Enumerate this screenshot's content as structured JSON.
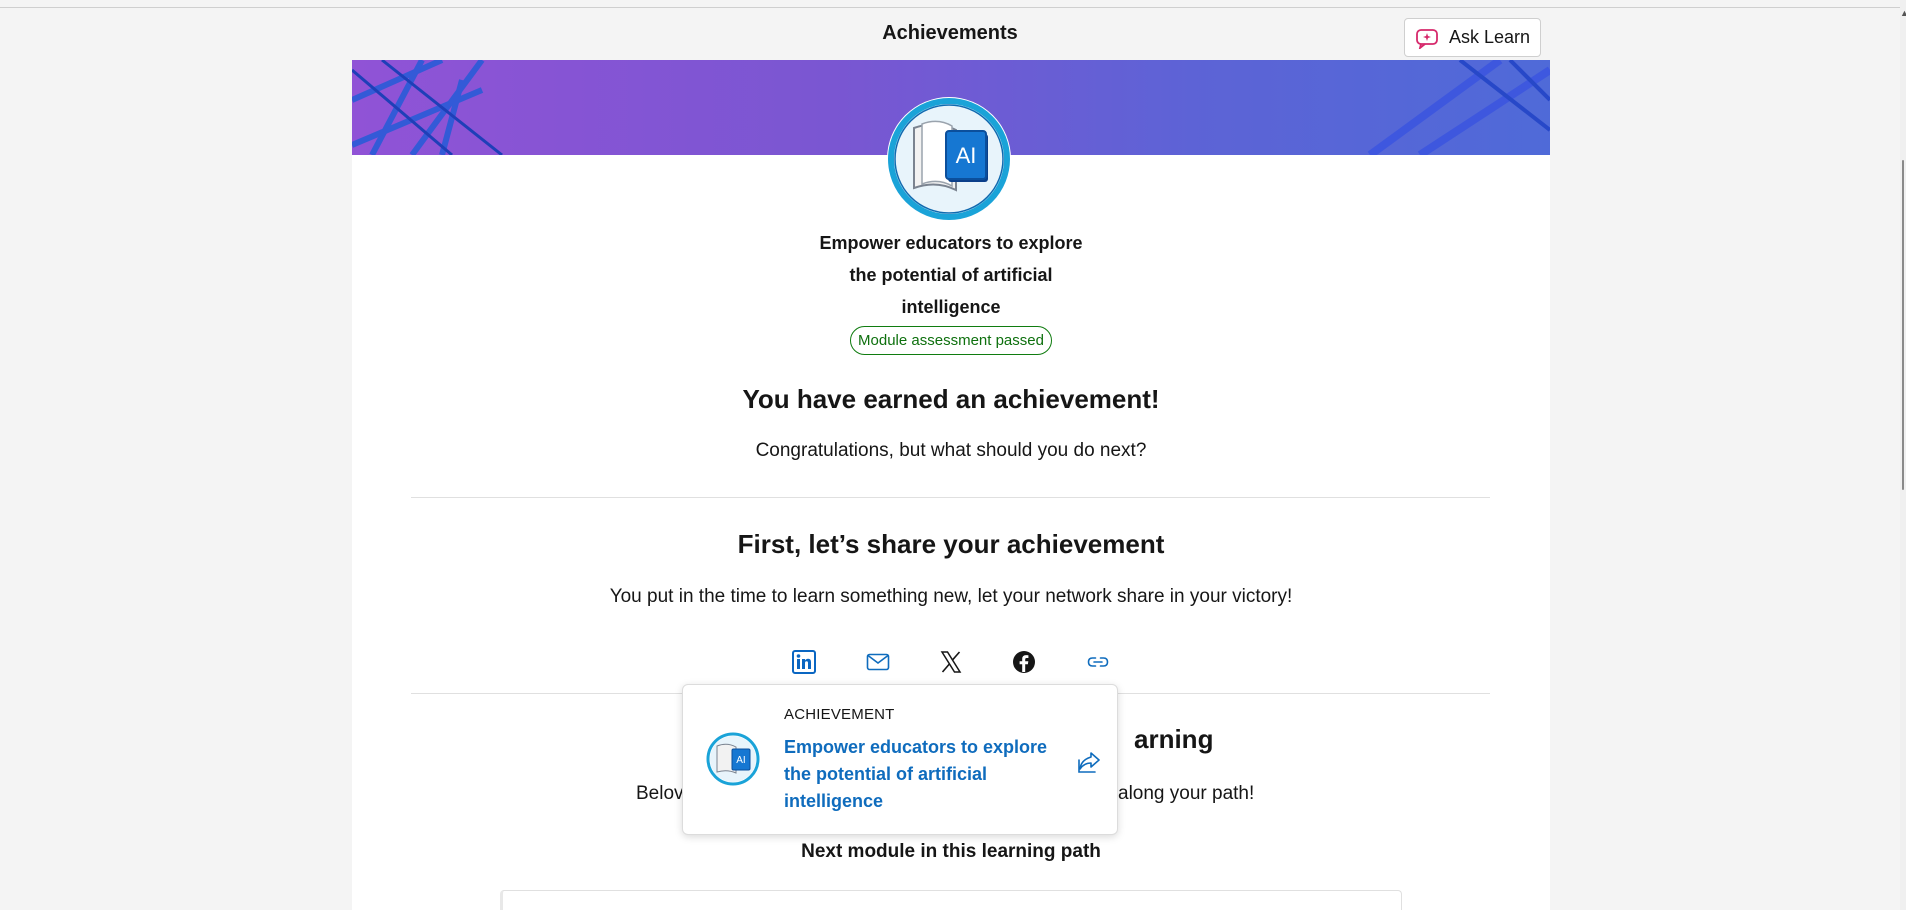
{
  "header": {
    "title": "Achievements",
    "ask_learn_label": "Ask Learn"
  },
  "module": {
    "title_lines": [
      "Empower educators to explore",
      "the potential of artificial",
      "intelligence"
    ],
    "badge_text": "AI",
    "status_pill": "Module assessment passed"
  },
  "earned": {
    "heading": "You have earned an achievement!",
    "subtext": "Congratulations, but what should you do next?"
  },
  "share": {
    "heading": "First, let’s share your achievement",
    "subtext": "You put in the time to learn something new, let your network share in your victory!",
    "icons": [
      "linkedin-icon",
      "mail-icon",
      "x-icon",
      "facebook-icon",
      "link-icon"
    ]
  },
  "learning": {
    "heading_visible": "arning",
    "subtext_left": "Belov",
    "subtext_right": "along your path!",
    "next_module_heading": "Next module in this learning path"
  },
  "popup": {
    "eyebrow": "ACHIEVEMENT",
    "link_lines": [
      "Empower educators to explore",
      "the potential of artificial",
      "intelligence"
    ],
    "badge_text": "AI"
  },
  "colors": {
    "link": "#0f6cbd",
    "pass": "#107c10",
    "banner_start": "#9053d6",
    "banner_end": "#4f6ad8"
  }
}
